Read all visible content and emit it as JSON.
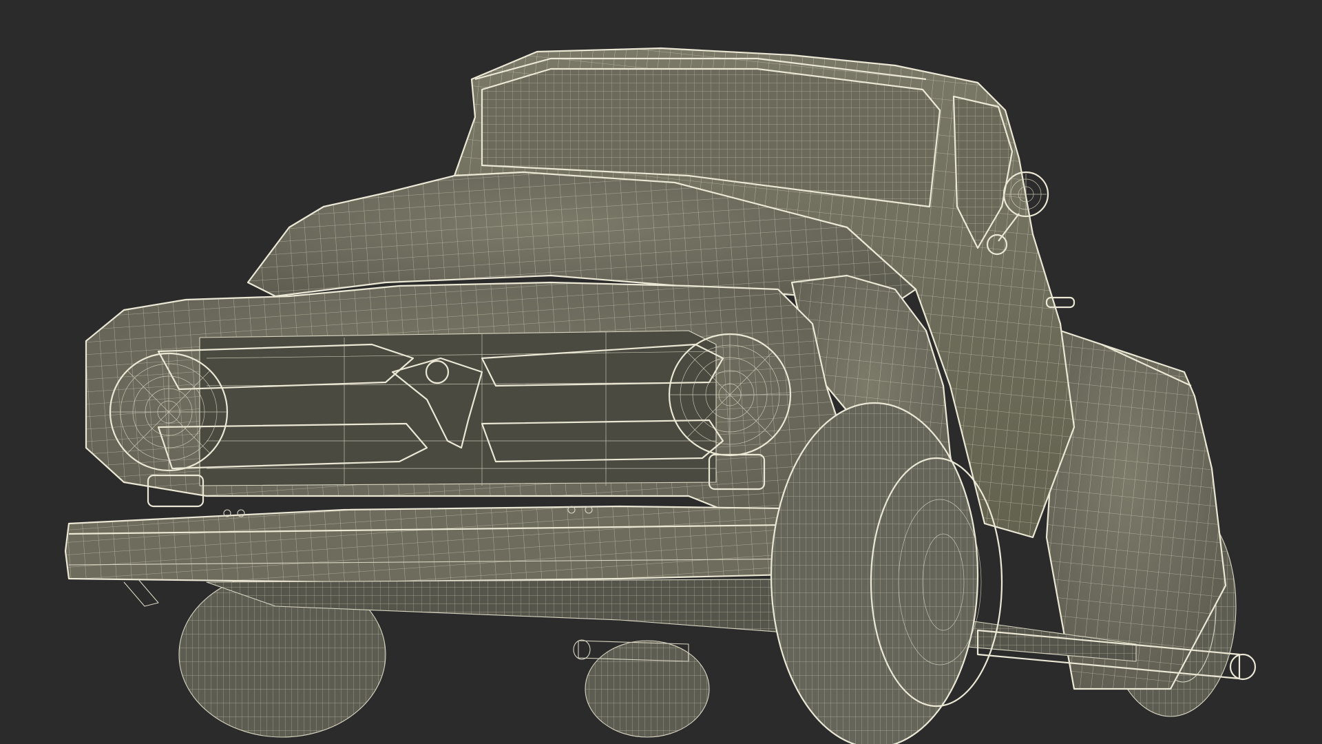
{
  "scene": {
    "subject": "truck-wireframe-render",
    "colors": {
      "background": "#2b2b2b",
      "body": "#6e6c5e",
      "body_shadow": "#5a5a4d",
      "body_highlight": "#84826f",
      "wire": "#d9d6c3",
      "tire": "#68675b",
      "tire_dark": "#4b4b42"
    }
  }
}
